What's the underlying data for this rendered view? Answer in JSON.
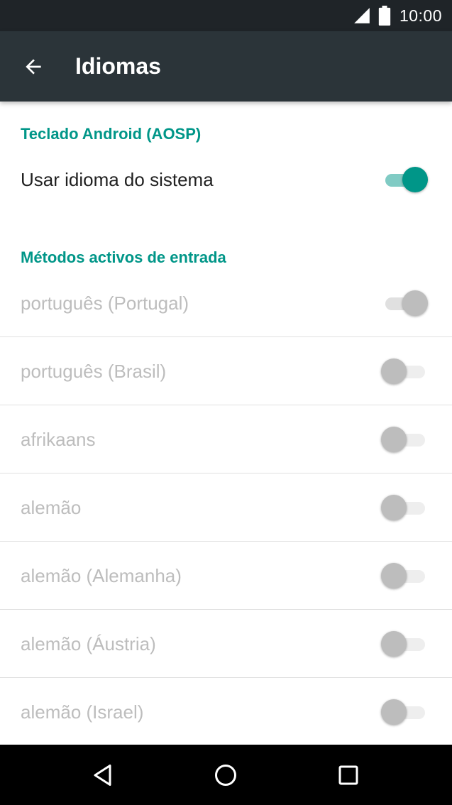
{
  "status_bar": {
    "time": "10:00",
    "icons": [
      "signal-icon",
      "battery-icon"
    ]
  },
  "app_bar": {
    "back_icon": "arrow-left-icon",
    "title": "Idiomas"
  },
  "sections": {
    "keyboard": {
      "header": "Teclado Android (AOSP)",
      "system_language": {
        "label": "Usar idioma do sistema",
        "checked": true,
        "enabled": true
      }
    },
    "input_methods": {
      "header": "Métodos activos de entrada",
      "items": [
        {
          "label": "português (Portugal)",
          "checked": true,
          "enabled": false
        },
        {
          "label": "português (Brasil)",
          "checked": false,
          "enabled": false
        },
        {
          "label": "afrikaans",
          "checked": false,
          "enabled": false
        },
        {
          "label": "alemão",
          "checked": false,
          "enabled": false
        },
        {
          "label": "alemão (Alemanha)",
          "checked": false,
          "enabled": false
        },
        {
          "label": "alemão (Áustria)",
          "checked": false,
          "enabled": false
        },
        {
          "label": "alemão (Israel)",
          "checked": false,
          "enabled": false
        }
      ]
    }
  },
  "colors": {
    "accent": "#009688",
    "accent_light": "#80cbc4",
    "app_bar": "#2b3439",
    "status_bar": "#1f2428",
    "disabled_text": "#bdbdbd"
  },
  "nav_bar": {
    "icons": [
      "back-triangle-icon",
      "home-circle-icon",
      "recents-square-icon"
    ]
  }
}
